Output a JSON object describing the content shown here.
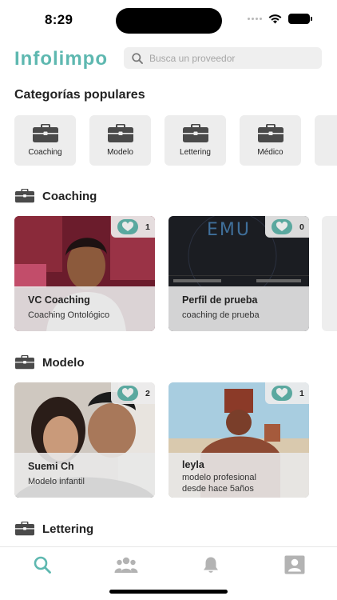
{
  "status_bar": {
    "time": "8:29"
  },
  "header": {
    "app_title": "Infolimpo",
    "search_placeholder": "Busca un proveedor"
  },
  "popular": {
    "title": "Categorías populares",
    "categories": [
      {
        "label": "Coaching",
        "icon": "briefcase-icon"
      },
      {
        "label": "Modelo",
        "icon": "briefcase-icon"
      },
      {
        "label": "Lettering",
        "icon": "briefcase-icon"
      },
      {
        "label": "Médico",
        "icon": "briefcase-icon"
      }
    ]
  },
  "sections": [
    {
      "title": "Coaching",
      "cards": [
        {
          "name": "VC Coaching",
          "description": "Coaching Ontológico",
          "likes": "1"
        },
        {
          "name": "Perfil de prueba",
          "description": "coaching de prueba",
          "likes": "0"
        }
      ]
    },
    {
      "title": "Modelo",
      "cards": [
        {
          "name": "Suemi Ch",
          "description": "Modelo infantil",
          "likes": "2"
        },
        {
          "name": "leyla",
          "description": "modelo profesional desde hace 5años",
          "likes": "1"
        }
      ]
    },
    {
      "title": "Lettering",
      "cards": []
    }
  ],
  "tab_bar": {
    "tabs": [
      {
        "icon": "search-icon",
        "active": true
      },
      {
        "icon": "group-icon",
        "active": false
      },
      {
        "icon": "bell-icon",
        "active": false
      },
      {
        "icon": "profile-icon",
        "active": false
      }
    ]
  },
  "colors": {
    "accent": "#5eb8b0",
    "chip_bg": "#ededed",
    "icon_gray": "#b3b3b3",
    "briefcase": "#4a4a4a"
  }
}
